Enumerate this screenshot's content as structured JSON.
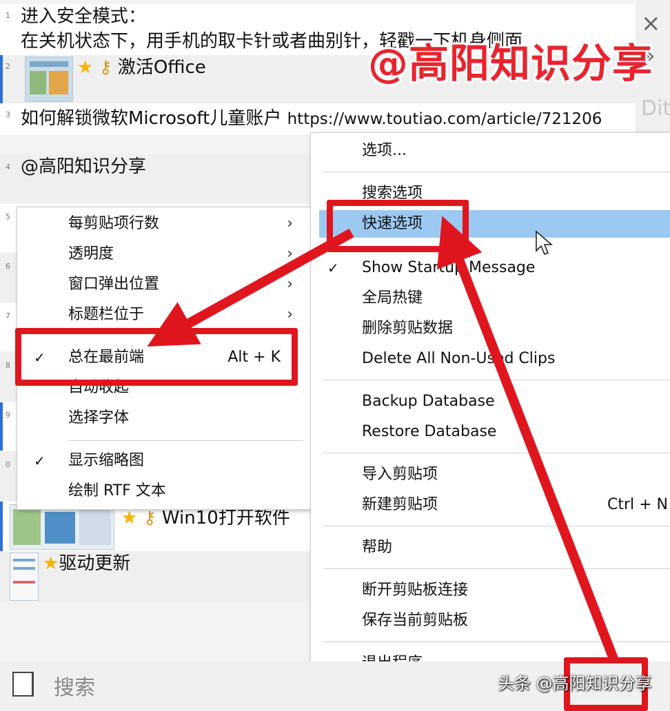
{
  "clips": {
    "r1": {
      "num": "1",
      "line1": "进入安全模式：",
      "line2": "在关机状态下，用手机的取卡针或者曲别针，轻戳一下机身侧面"
    },
    "r2": {
      "num": "2",
      "text": "激活Office"
    },
    "r3": {
      "num": "3",
      "text": "如何解锁微软Microsoft儿童账户",
      "url": "https://www.toutiao.com/article/721206"
    },
    "r4": {
      "num": "4",
      "text": "@高阳知识分享"
    },
    "r5": {
      "num": "5"
    },
    "r6": {
      "num": "6"
    },
    "r7": {
      "num": "7"
    },
    "r8": {
      "num": "8"
    },
    "r9": {
      "num": "9"
    },
    "r10": {
      "num": "0"
    },
    "r11": {
      "text": "Win10打开软件"
    },
    "r12": {
      "text": "驱动更新"
    }
  },
  "side": {
    "close": "×",
    "more": "»",
    "app_title": "Dit"
  },
  "watermark": "@高阳知识分享",
  "left_menu": {
    "items": [
      {
        "label": "每剪贴项行数",
        "arrow": "›"
      },
      {
        "label": "透明度",
        "arrow": "›"
      },
      {
        "label": "窗口弹出位置",
        "arrow": "›"
      },
      {
        "label": "标题栏位于",
        "arrow": "›"
      },
      {
        "label": "总在最前端",
        "check": "✓",
        "shortcut": "Alt + K"
      },
      {
        "label": "自动收起"
      },
      {
        "label": "选择字体"
      },
      {
        "label": "显示缩略图",
        "check": "✓"
      },
      {
        "label": "绘制 RTF 文本"
      }
    ]
  },
  "right_menu": {
    "items": [
      {
        "label": "选项..."
      },
      {
        "label": "搜索选项"
      },
      {
        "label": "快速选项"
      },
      {
        "label": "Show Startup Message",
        "check": "✓"
      },
      {
        "label": "全局热键"
      },
      {
        "label": "删除剪贴数据"
      },
      {
        "label": "Delete All Non-Used Clips"
      },
      {
        "label": "Backup Database"
      },
      {
        "label": "Restore Database"
      },
      {
        "label": "导入剪贴项"
      },
      {
        "label": "新建剪贴项",
        "shortcut": "Ctrl + N"
      },
      {
        "label": "帮助"
      },
      {
        "label": "断开剪贴板连接"
      },
      {
        "label": "保存当前剪贴板"
      },
      {
        "label": "退出程序"
      }
    ]
  },
  "search": {
    "label": "搜索"
  },
  "credit": "头条 @高阳知识分享",
  "colors": {
    "annotation_red": "#e0161e",
    "highlight": "#9cc9f2",
    "accent_bar": "#2f6fd6"
  }
}
